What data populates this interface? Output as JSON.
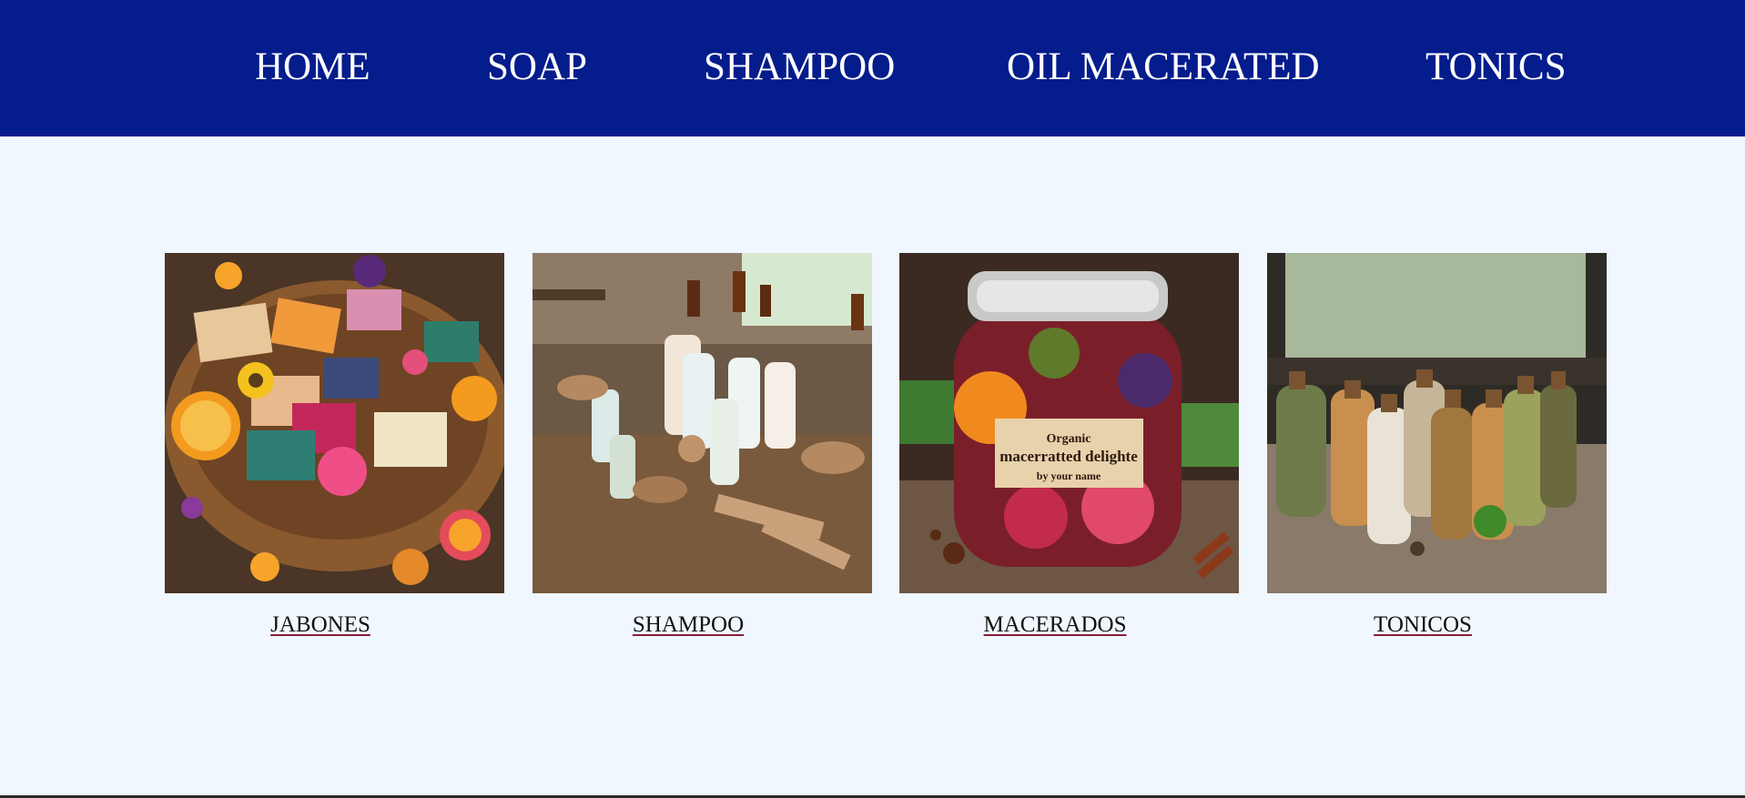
{
  "nav": {
    "items": [
      {
        "label": "HOME"
      },
      {
        "label": "SOAP"
      },
      {
        "label": "SHAMPOO"
      },
      {
        "label": "OIL MACERATED"
      },
      {
        "label": "TONICS"
      }
    ]
  },
  "cards": [
    {
      "link_label": "JABONES",
      "image_icon": "soap-basket-photo"
    },
    {
      "link_label": "SHAMPOO",
      "image_icon": "shampoo-bottles-photo"
    },
    {
      "link_label": "MACERADOS",
      "image_icon": "macerated-jar-photo",
      "jar_label": {
        "line1": "Organic",
        "line2": "macerratted delighte",
        "line3": "by your name"
      }
    },
    {
      "link_label": "TONICOS",
      "image_icon": "tonic-bottles-photo"
    }
  ],
  "colors": {
    "nav_background": "#041c8c",
    "page_background": "#f0f7ff",
    "nav_text": "#ffffff",
    "link_text": "#111111"
  }
}
